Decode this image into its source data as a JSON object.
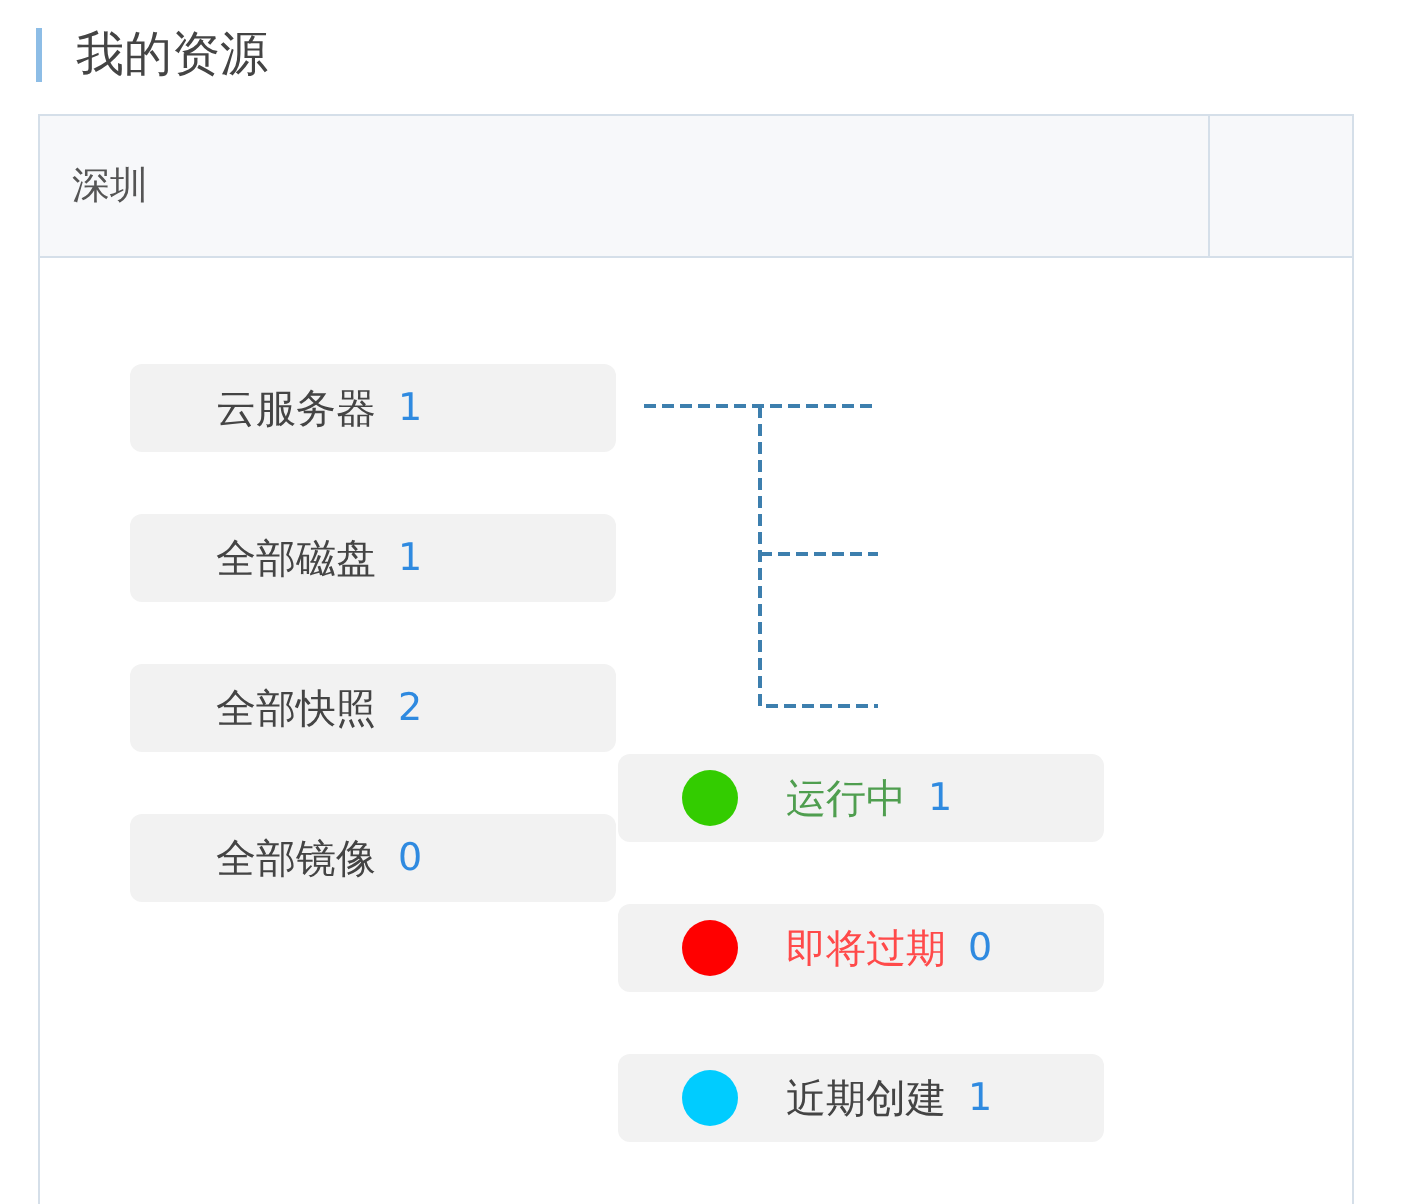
{
  "title": "我的资源",
  "table": {
    "columns": [
      "深圳"
    ]
  },
  "resources": [
    {
      "label": "云服务器",
      "count": "1"
    },
    {
      "label": "全部磁盘",
      "count": "1"
    },
    {
      "label": "全部快照",
      "count": "2"
    },
    {
      "label": "全部镜像",
      "count": "0"
    }
  ],
  "statuses": [
    {
      "kind": "running",
      "label": "运行中",
      "count": "1",
      "color": "#33cc00"
    },
    {
      "kind": "expiring",
      "label": "即将过期",
      "count": "0",
      "color": "#ff0000"
    },
    {
      "kind": "recent",
      "label": "近期创建",
      "count": "1",
      "color": "#00ccff"
    }
  ]
}
